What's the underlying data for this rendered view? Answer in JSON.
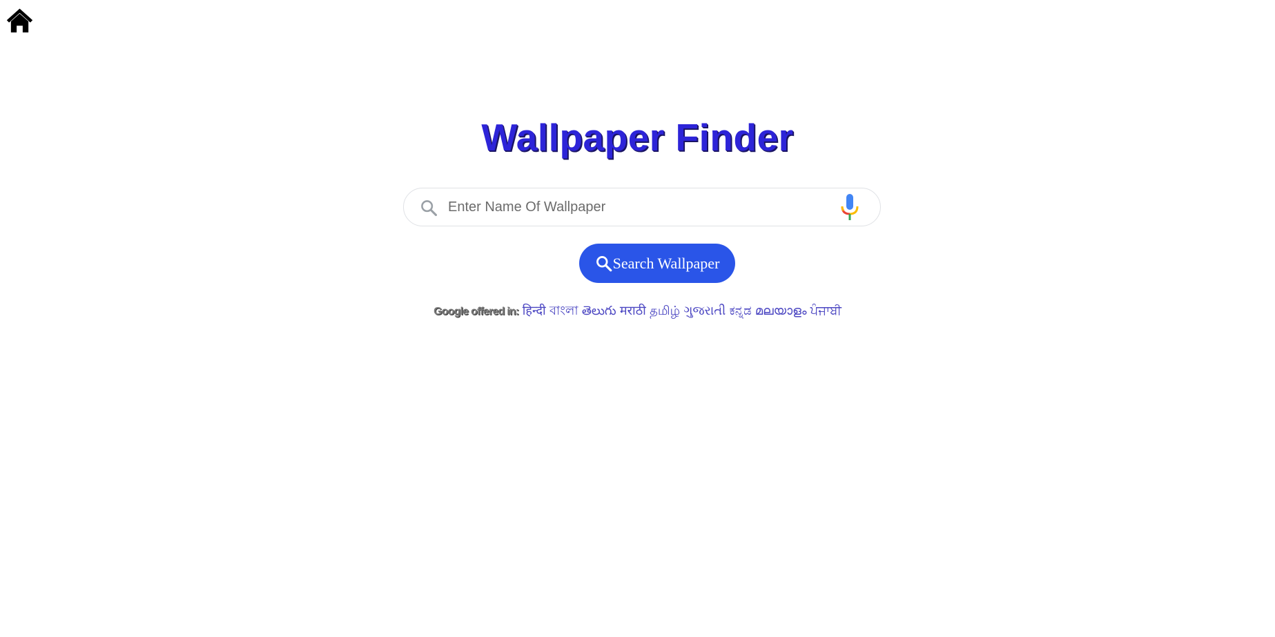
{
  "nav": {
    "home_icon": "home-icon"
  },
  "header": {
    "title": "Wallpaper Finder",
    "title_color": "#2d24d8"
  },
  "search": {
    "placeholder": "Enter Name Of Wallpaper",
    "value": "",
    "search_icon": "search-icon",
    "mic_icon": "microphone-icon"
  },
  "button": {
    "label": "Search Wallpaper",
    "icon": "search-icon",
    "color": "#2a55e8"
  },
  "languages": {
    "label": "Google offered in:",
    "items": [
      "हिन्दी",
      "বাংলা",
      "తెలుగు",
      "मराठी",
      "தமிழ்",
      "ગુજરાતી",
      "ಕನ್ನಡ",
      "മലയാളം",
      "ਪੰਜਾਬੀ"
    ],
    "link_color": "#4b46c2"
  }
}
